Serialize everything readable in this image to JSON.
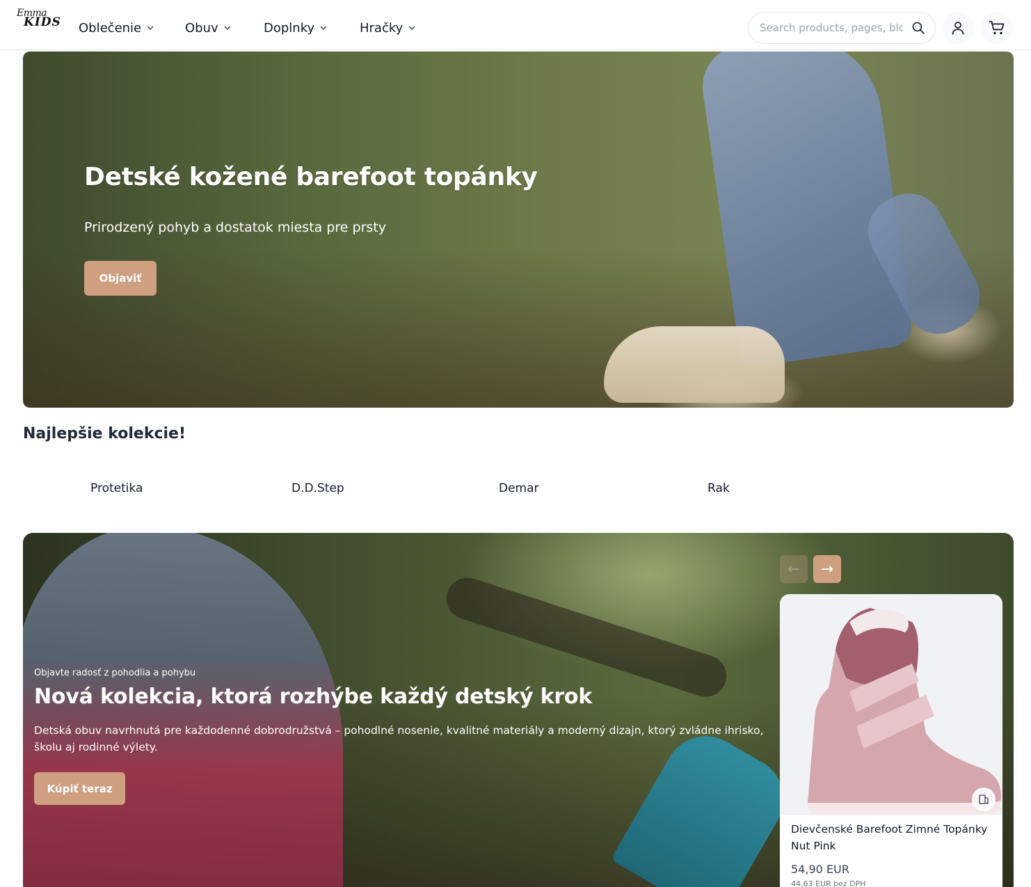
{
  "header": {
    "logo_line1": "Emma",
    "logo_line2": "KIDS",
    "nav": [
      {
        "label": "Oblečenie"
      },
      {
        "label": "Obuv"
      },
      {
        "label": "Doplnky"
      },
      {
        "label": "Hračky"
      }
    ],
    "search": {
      "placeholder": "Search products, pages, blogs..."
    },
    "icons": {
      "user": "user-icon",
      "cart": "cart-icon",
      "search": "search-icon",
      "chevron": "chevron-down-icon"
    }
  },
  "hero1": {
    "title": "Detské kožené barefoot topánky",
    "subtitle": "Prirodzený pohyb a dostatok miesta pre prsty",
    "button": "Objaviť"
  },
  "collections": {
    "title": "Najlepšie kolekcie!",
    "items": [
      {
        "label": "Protetika"
      },
      {
        "label": "D.D.Step"
      },
      {
        "label": "Demar"
      },
      {
        "label": "Rak"
      }
    ]
  },
  "hero2": {
    "kicker": "Objavte radosť z pohodlia a pohybu",
    "title": "Nová kolekcia, ktorá rozhýbe každý detský krok",
    "description": "Detská obuv navrhnutá pre každodenné dobrodružstvá – pohodlné nosenie, kvalitné materiály a moderný dizajn, ktorý zvládne ihrisko, školu aj rodinné výlety.",
    "button": "Kúpiť teraz",
    "arrows": {
      "prev": "←",
      "next": "→"
    },
    "product": {
      "name": "Dievčenské Barefoot Zimné Topánky Nut Pink",
      "price": "54,90 EUR",
      "price_net": "44,63 EUR bez DPH"
    }
  },
  "colors": {
    "accent": "#cfa07f",
    "accent_disabled": "#b8957a",
    "text": "#111827",
    "border": "#e5e7eb"
  }
}
